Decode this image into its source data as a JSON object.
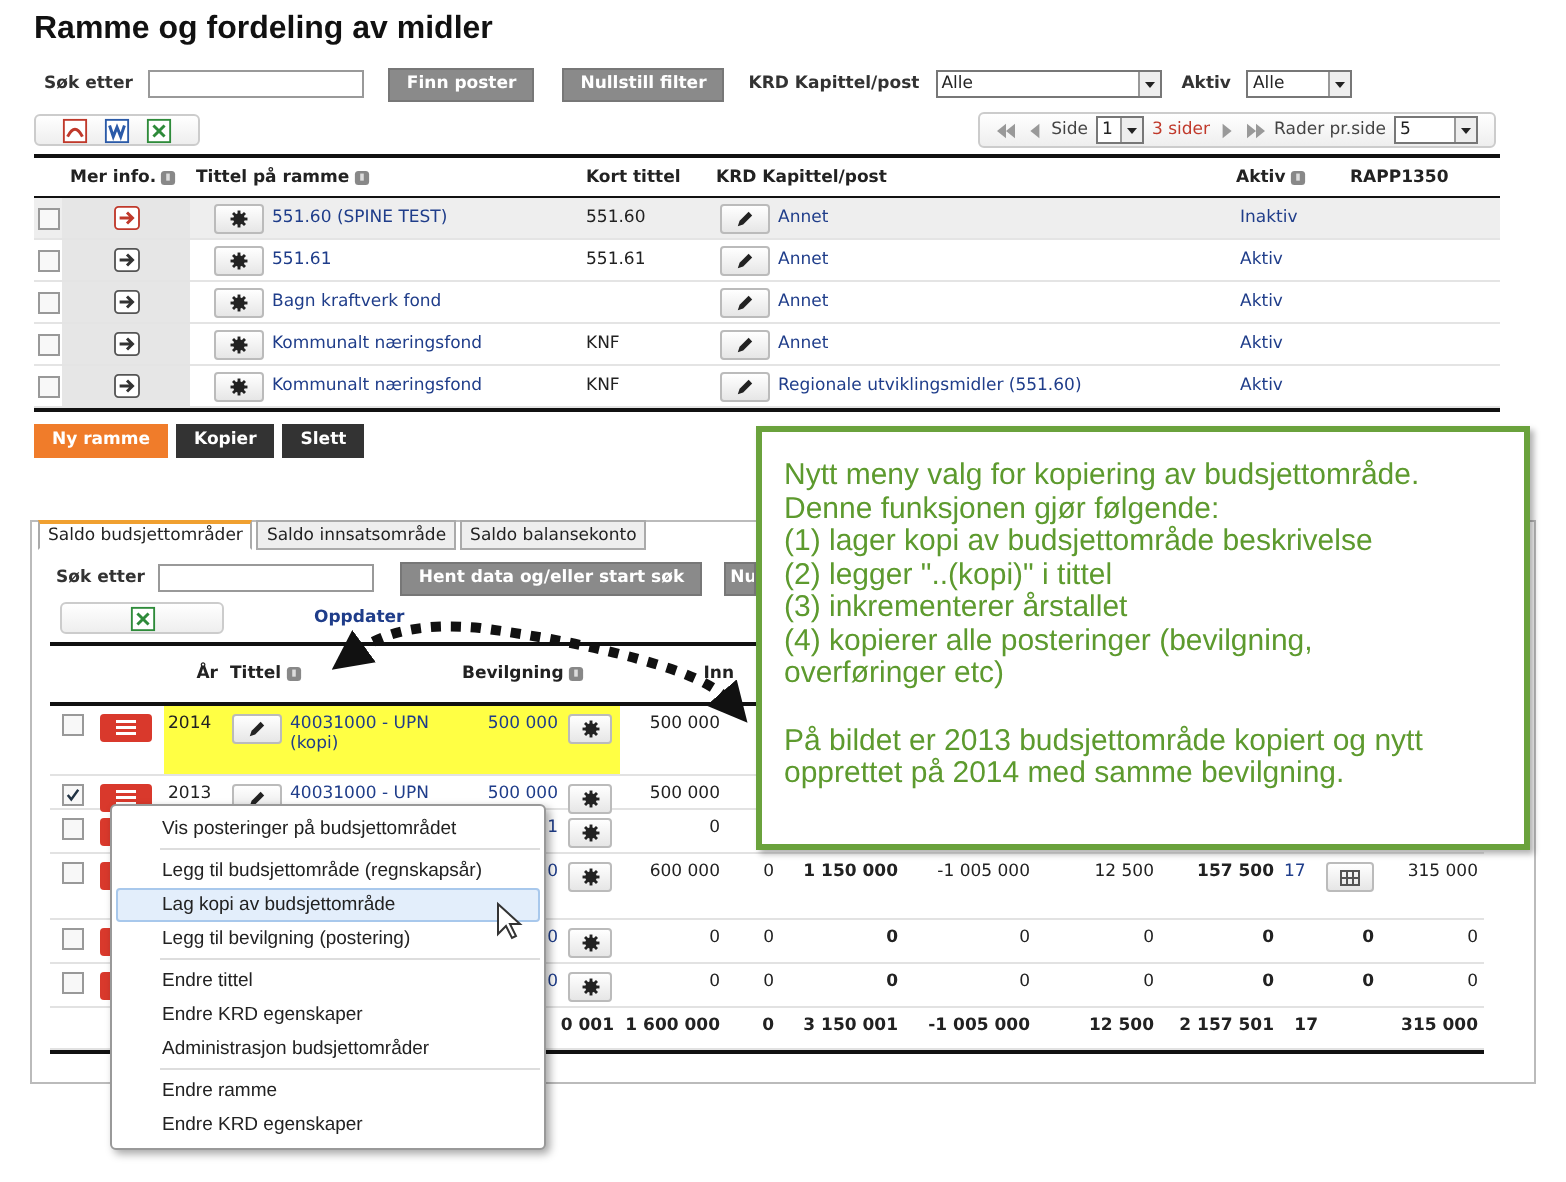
{
  "page_title": "Ramme og fordeling av midler",
  "filter": {
    "search_label": "Søk etter",
    "find_button": "Finn poster",
    "reset_button": "Nullstill filter",
    "krd_label": "KRD Kapittel/post",
    "krd_value": "Alle",
    "active_label": "Aktiv",
    "active_value": "Alle"
  },
  "export_icons": [
    {
      "kind": "pdf"
    },
    {
      "kind": "word"
    },
    {
      "kind": "excel"
    }
  ],
  "pager": {
    "page_label": "Side",
    "page_value": "1",
    "pages": "3 sider",
    "rows_label": "Rader pr.side",
    "rows_value": "5"
  },
  "frames_table": {
    "columns": [
      {
        "label": "Mer info.",
        "help": true
      },
      {
        "label": "Tittel på ramme",
        "help": true
      },
      {
        "label": "Kort tittel",
        "help": false
      },
      {
        "label": "KRD Kapittel/post",
        "help": false
      },
      {
        "label": "Aktiv",
        "help": true
      },
      {
        "label": "RAPP1350",
        "help": false
      }
    ],
    "rows": [
      {
        "checked": false,
        "highlighted": true,
        "alert": true,
        "title": "551.60 (SPINE TEST)",
        "short_title": "551.60",
        "krd": "Annet",
        "active": "Inaktiv"
      },
      {
        "checked": false,
        "highlighted": false,
        "alert": false,
        "title": "551.61",
        "short_title": "551.61",
        "krd": "Annet",
        "active": "Aktiv"
      },
      {
        "checked": false,
        "highlighted": false,
        "alert": false,
        "title": "Bagn kraftverk fond",
        "krd": "Annet",
        "active": "Aktiv"
      },
      {
        "checked": false,
        "highlighted": false,
        "alert": false,
        "title": "Kommunalt næringsfond",
        "short_title": "KNF",
        "krd": "Annet",
        "active": "Aktiv"
      },
      {
        "checked": false,
        "highlighted": false,
        "alert": false,
        "title": "Kommunalt næringsfond",
        "short_title": "KNF",
        "krd": "Regionale utviklingsmidler (551.60)",
        "active": "Aktiv"
      }
    ]
  },
  "frame_buttons": [
    {
      "label": "Ny ramme",
      "kind": "primary"
    },
    {
      "label": "Kopier",
      "kind": "dark"
    },
    {
      "label": "Slett",
      "kind": "dark"
    }
  ],
  "tabs": [
    {
      "label": "Saldo budsjettområder",
      "selected": true
    },
    {
      "label": "Saldo innsatsområde",
      "selected": false
    },
    {
      "label": "Saldo balansekonto",
      "selected": false
    }
  ],
  "budget": {
    "search_label": "Søk etter",
    "fetch_button": "Hent data og/eller start søk",
    "second_button": "Nu",
    "refresh_link": "Oppdater",
    "columns": [
      {
        "label": "År",
        "help": false
      },
      {
        "label": "Tittel",
        "help": true
      },
      {
        "label": "Bevilgning",
        "help": true
      },
      {
        "label": "Inn",
        "help": false
      }
    ],
    "rows": [
      {
        "kind": "row",
        "checked": false,
        "highlighted": true,
        "grid_button": false,
        "cells": {
          "year": "2014",
          "title": "40031000 - UPN (kopi)",
          "bevilgning": "500 000",
          "inn": "500 000"
        }
      },
      {
        "kind": "row",
        "checked": true,
        "highlighted": false,
        "grid_button": false,
        "cells": {
          "year": "2013",
          "title": "40031000 - UPN",
          "bevilgning": "500 000",
          "inn": "500 000"
        }
      },
      {
        "kind": "row",
        "checked": false,
        "highlighted": false,
        "grid_button": false,
        "cells": {
          "bevilgning": "1",
          "inn": "0"
        }
      },
      {
        "kind": "row",
        "checked": false,
        "highlighted": false,
        "grid_button": true,
        "cells": {
          "bevilgning": "0",
          "inn": "600 000",
          "column_7": "0",
          "column_8": "1 150 000",
          "column_9": "-1 005 000",
          "column_10": "12 500",
          "column_11": "157 500",
          "column_12": "17",
          "column_14": "315 000"
        }
      },
      {
        "kind": "row",
        "checked": false,
        "highlighted": false,
        "grid_button": false,
        "cells": {
          "bevilgning": "0",
          "inn": "0",
          "column_7": "0",
          "column_8": "0",
          "column_9": "0",
          "column_10": "0",
          "column_11": "0",
          "column_13": "0",
          "column_14": "0"
        }
      },
      {
        "kind": "row",
        "checked": false,
        "highlighted": false,
        "grid_button": false,
        "cells": {
          "bevilgning": "0",
          "inn": "0",
          "column_7": "0",
          "column_8": "0",
          "column_9": "0",
          "column_10": "0",
          "column_11": "0",
          "column_13": "0",
          "column_14": "0"
        }
      },
      {
        "kind": "total",
        "cells": {
          "bevilgning": "0 001",
          "inn": "1 600 000",
          "column_7": "0",
          "column_8": "3 150 001",
          "column_9": "-1 005 000",
          "column_10": "12 500",
          "column_11": "2 157 501",
          "column_12": "17",
          "column_14": "315 000"
        }
      }
    ]
  },
  "context_menu": {
    "groups": [
      [
        {
          "label": "Vis posteringer på budsjettområdet",
          "selected": false
        }
      ],
      [
        {
          "label": "Legg til budsjettområde (regnskapsår)",
          "selected": false
        },
        {
          "label": "Lag kopi av budsjettområde",
          "selected": true
        },
        {
          "label": "Legg til bevilgning (postering)",
          "selected": false
        }
      ],
      [
        {
          "label": "Endre tittel",
          "selected": false
        },
        {
          "label": "Endre KRD egenskaper",
          "selected": false
        },
        {
          "label": "Administrasjon budsjettområder",
          "selected": false
        }
      ],
      [
        {
          "label": "Endre ramme",
          "selected": false
        },
        {
          "label": "Endre KRD egenskaper",
          "selected": false
        }
      ]
    ]
  },
  "callout": {
    "paragraphs": [
      [
        "Nytt meny valg for kopiering av budsjettområde.",
        "Denne funksjonen gjør følgende:",
        "(1) lager kopi av budsjettområde beskrivelse",
        "(2) legger \"..(kopi)\" i tittel",
        "(3) inkrementerer årstallet",
        "(4) kopierer alle posteringer (bevilgning, overføringer etc)"
      ],
      [
        "På bildet er 2013 budsjettområde kopiert og nytt opprettet på 2014 med samme bevilgning."
      ]
    ]
  }
}
